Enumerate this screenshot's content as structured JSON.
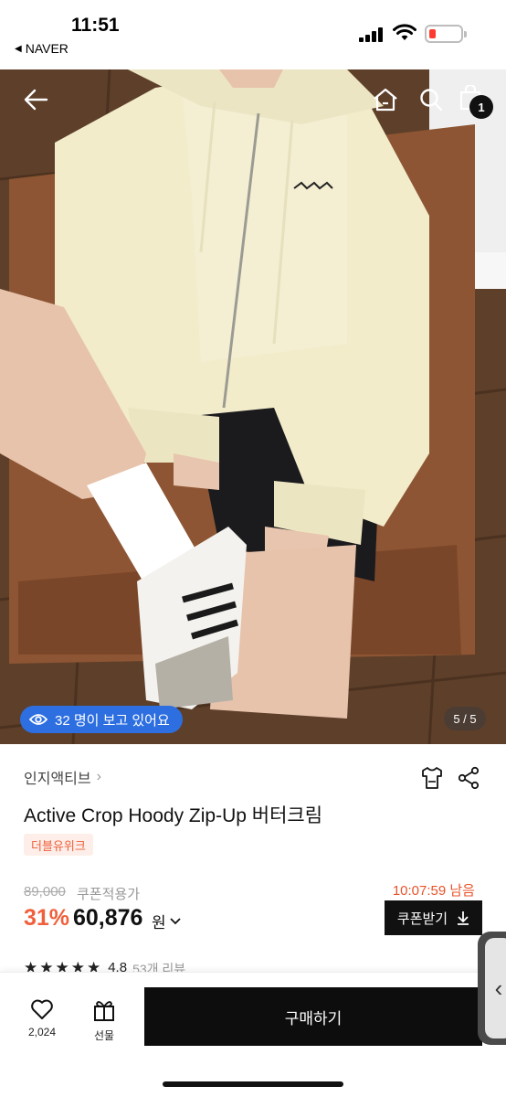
{
  "status_bar": {
    "time": "11:51",
    "back_app": "NAVER"
  },
  "hero": {
    "viewer_text": "32 명이 보고 있어요",
    "page_counter": "5 / 5",
    "cart_count": "1",
    "icons": [
      "back-arrow-icon",
      "home-icon",
      "search-icon",
      "shopping-bag-icon"
    ]
  },
  "product": {
    "brand": "인지액티브",
    "title": "Active Crop Hoody Zip-Up 버터크림",
    "tag": "더블유위크",
    "original_price": "89,000",
    "coupon_label": "쿠폰적용가",
    "timer": "10:07:59 남음",
    "discount": "31%",
    "price": "60,876",
    "currency": "원",
    "coupon_button": "쿠폰받기",
    "rating": "4.8",
    "reviews": "53개 리뷰"
  },
  "bottom_bar": {
    "like_count": "2,024",
    "gift_label": "선물",
    "buy_label": "구매하기"
  },
  "colors": {
    "accent": "#f0603c",
    "viewer_pill": "#2d6fe0",
    "button_dark": "#111111"
  }
}
